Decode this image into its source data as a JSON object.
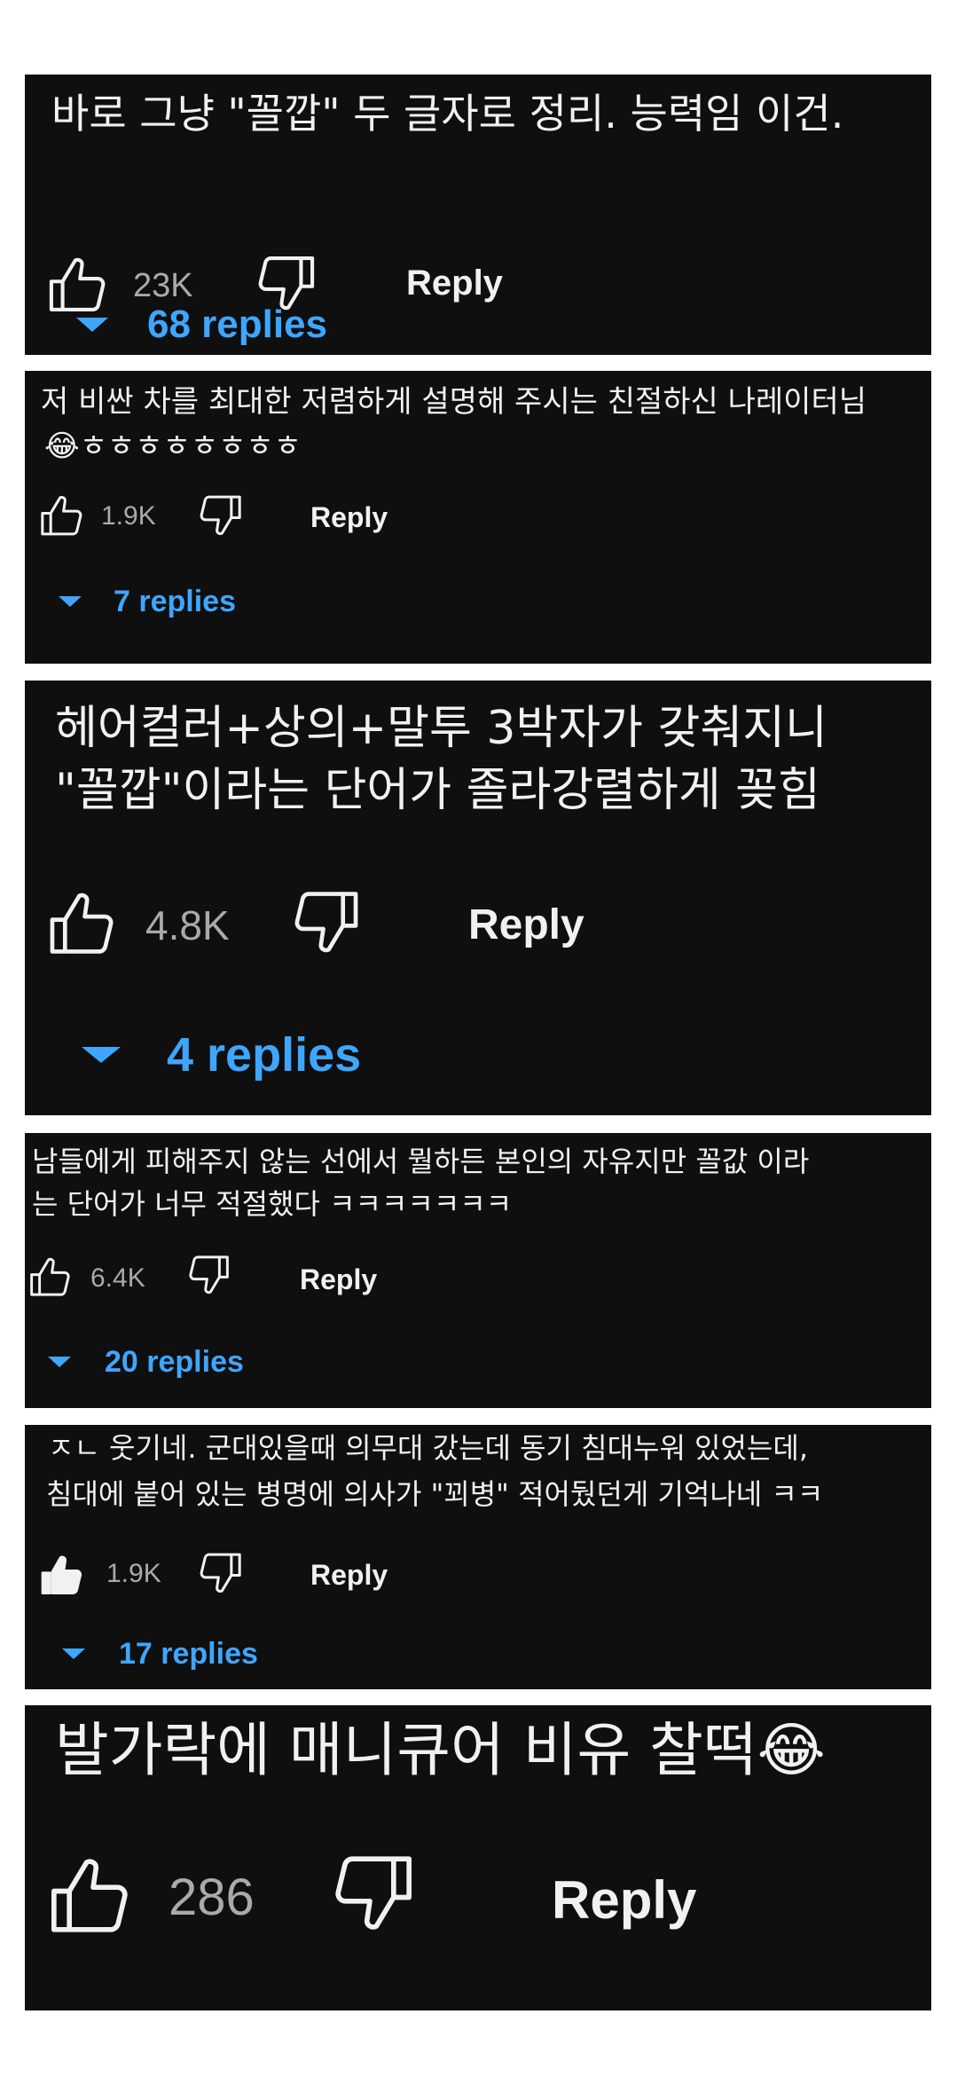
{
  "colors": {
    "card_bg": "#0f0f0f",
    "text": "#f1f1f1",
    "count": "#aaaaaa",
    "link_blue": "#3ea6ff"
  },
  "comments": [
    {
      "lines": [
        "바로 그냥 \"꼴깝\" 두 글자로 정리. 능력임 이건."
      ],
      "likes": "23K",
      "reply_label": "Reply",
      "replies_label": "68 replies",
      "like_icon": "thumbs-up-outline-icon",
      "dislike_icon": "thumbs-down-outline-icon"
    },
    {
      "lines": [
        "저 비싼 차를 최대한 저렴하게 설명해 주시는 친절하신 나레이터님",
        "😂ㅎㅎㅎㅎㅎㅎㅎㅎ"
      ],
      "likes": "1.9K",
      "reply_label": "Reply",
      "replies_label": "7 replies",
      "like_icon": "thumbs-up-outline-icon",
      "dislike_icon": "thumbs-down-outline-icon"
    },
    {
      "lines": [
        "헤어컬러+상의+말투 3박자가 갖춰지니",
        "\"꼴깝\"이라는 단어가 졸라강렬하게 꽂힘"
      ],
      "likes": "4.8K",
      "reply_label": "Reply",
      "replies_label": "4 replies",
      "like_icon": "thumbs-up-outline-icon",
      "dislike_icon": "thumbs-down-outline-icon"
    },
    {
      "lines": [
        "남들에게 피해주지 않는 선에서 뭘하든 본인의 자유지만 꼴값 이라",
        "는 단어가 너무 적절했다 ㅋㅋㅋㅋㅋㅋㅋ"
      ],
      "likes": "6.4K",
      "reply_label": "Reply",
      "replies_label": "20 replies",
      "like_icon": "thumbs-up-outline-icon",
      "dislike_icon": "thumbs-down-outline-icon"
    },
    {
      "lines": [
        "ㅈㄴ 웃기네. 군대있을때 의무대 갔는데 동기 침대누워 있었는데,",
        "침대에 붙어 있는 병명에 의사가 \"꾀병\" 적어뒀던게 기억나네 ㅋㅋ"
      ],
      "likes": "1.9K",
      "reply_label": "Reply",
      "replies_label": "17 replies",
      "like_icon": "thumbs-up-filled-icon",
      "dislike_icon": "thumbs-down-outline-icon"
    },
    {
      "lines": [
        "발가락에 매니큐어 비유 찰떡😂"
      ],
      "likes": "286",
      "reply_label": "Reply",
      "replies_label": "",
      "like_icon": "thumbs-up-outline-icon",
      "dislike_icon": "thumbs-down-outline-icon"
    }
  ]
}
